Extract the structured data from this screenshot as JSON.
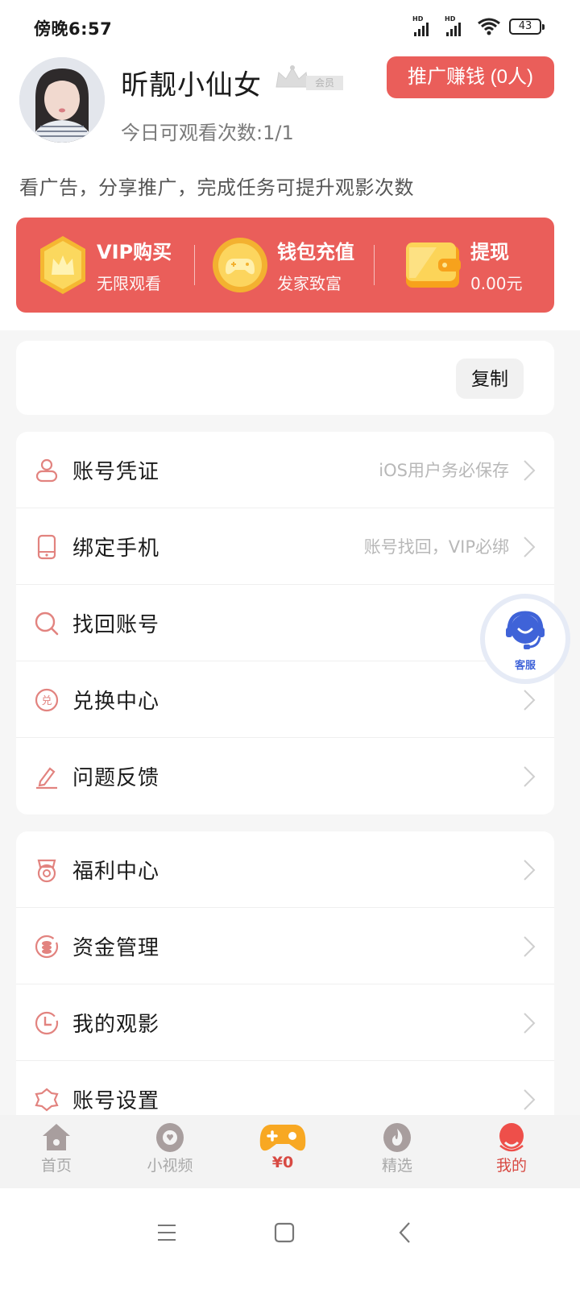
{
  "status_bar": {
    "time": "傍晚6:57",
    "signal1_label": "HD",
    "signal2_label": "HD",
    "battery": "43"
  },
  "profile": {
    "username": "昕靓小仙女",
    "member_tag": "会员",
    "watch_count": "今日可观看次数:1/1",
    "promote_button": "推广赚钱 (0人)",
    "hint": "看广告，分享推广，完成任务可提升观影次数"
  },
  "banner": {
    "items": [
      {
        "title": "VIP购买",
        "subtitle": "无限观看",
        "icon": "vip-crown-icon"
      },
      {
        "title": "钱包充值",
        "subtitle": "发家致富",
        "icon": "gamepad-coin-icon"
      },
      {
        "title": "提现",
        "subtitle": "0.00元",
        "icon": "wallet-icon"
      }
    ]
  },
  "copy_card": {
    "button": "复制"
  },
  "menu_group1": [
    {
      "label": "账号凭证",
      "sub": "iOS用户务必保存",
      "icon": "user-credential-icon"
    },
    {
      "label": "绑定手机",
      "sub": "账号找回，VIP必绑",
      "icon": "phone-icon"
    },
    {
      "label": "找回账号",
      "sub": "",
      "icon": "search-icon"
    },
    {
      "label": "兑换中心",
      "sub": "",
      "icon": "exchange-icon"
    },
    {
      "label": "问题反馈",
      "sub": "",
      "icon": "edit-icon"
    }
  ],
  "menu_group2": [
    {
      "label": "福利中心",
      "sub": "",
      "icon": "gift-icon"
    },
    {
      "label": "资金管理",
      "sub": "",
      "icon": "coins-icon"
    },
    {
      "label": "我的观影",
      "sub": "",
      "icon": "clock-icon"
    },
    {
      "label": "账号设置",
      "sub": "",
      "icon": "settings-icon"
    }
  ],
  "customer_service": {
    "label": "客服"
  },
  "tabbar": {
    "items": [
      {
        "label": "首页",
        "icon": "home-icon",
        "active": false
      },
      {
        "label": "小视频",
        "icon": "short-video-icon",
        "active": false
      },
      {
        "label": "¥0",
        "icon": "game-controller-icon",
        "active": false
      },
      {
        "label": "精选",
        "icon": "flame-icon",
        "active": false
      },
      {
        "label": "我的",
        "icon": "profile-icon",
        "active": true
      }
    ]
  },
  "colors": {
    "accent_red": "#ea5e5a",
    "active_tab": "#d84a43",
    "cs_blue": "#3f63d8",
    "icon_pink": "#e2837f"
  }
}
